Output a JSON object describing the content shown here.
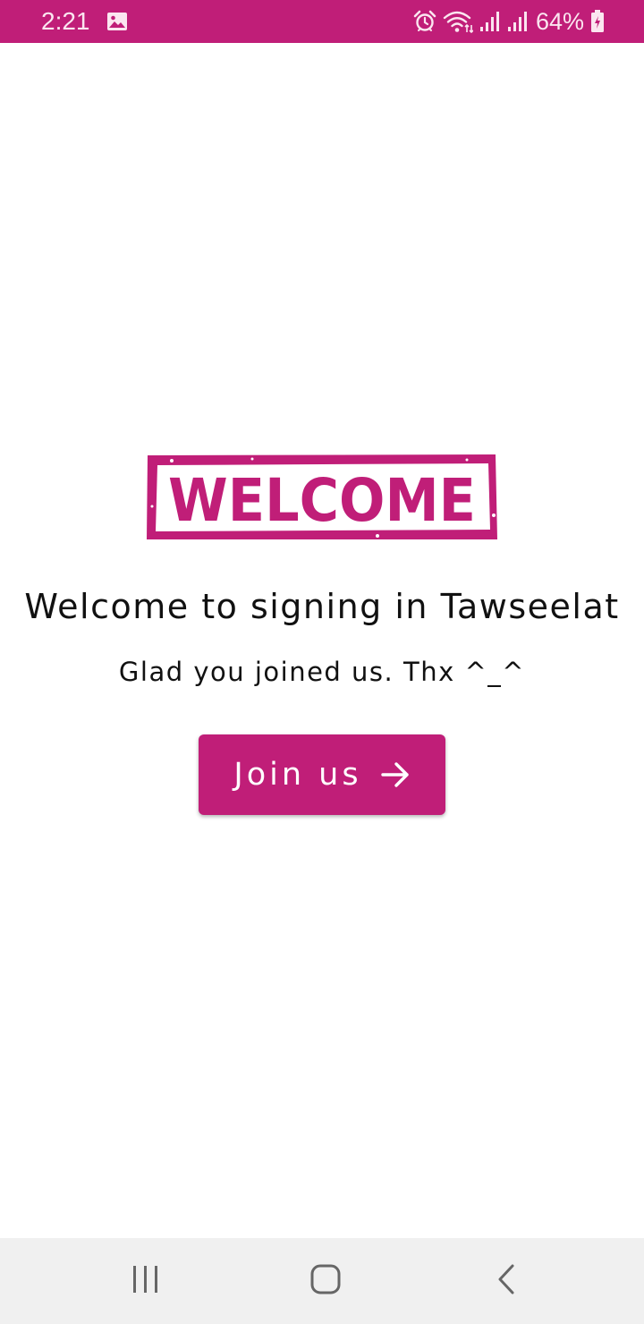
{
  "status_bar": {
    "time": "2:21",
    "battery": "64%",
    "background_color": "#c01e78",
    "icons": [
      "gallery-icon",
      "alarm-icon",
      "wifi-icon",
      "signal-icon",
      "signal-icon",
      "battery-charging-icon"
    ]
  },
  "main": {
    "logo_text": "WELCOME",
    "title": "Welcome to signing in Tawseelat",
    "subtitle": "Glad you joined us. Thx ^_^",
    "join_button": {
      "label": "Join us",
      "icon": "arrow-right-icon",
      "color": "#c01e78"
    }
  },
  "nav_bar": {
    "buttons": [
      "recent-apps-icon",
      "home-icon",
      "back-icon"
    ]
  }
}
